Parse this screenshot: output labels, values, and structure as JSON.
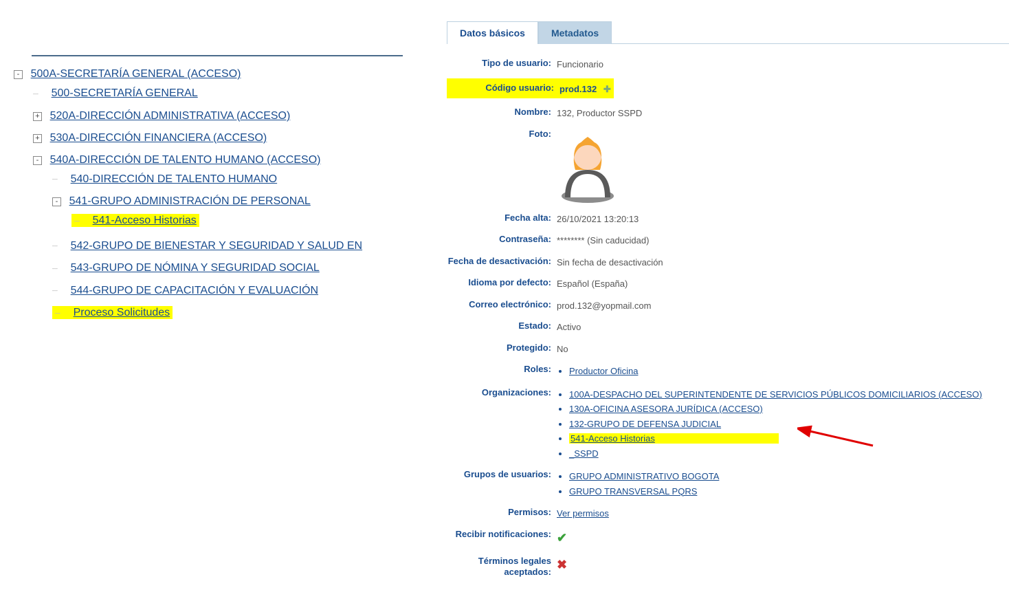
{
  "tree": {
    "root": {
      "exp": "-",
      "label": "500A-SECRETARÍA GENERAL (ACCESO)",
      "children": [
        {
          "exp": "",
          "label": "500-SECRETARÍA GENERAL"
        },
        {
          "exp": "+",
          "label": "520A-DIRECCIÓN ADMINISTRATIVA (ACCESO)"
        },
        {
          "exp": "+",
          "label": "530A-DIRECCIÓN FINANCIERA (ACCESO)"
        },
        {
          "exp": "-",
          "label": "540A-DIRECCIÓN DE TALENTO HUMANO (ACCESO)",
          "children": [
            {
              "exp": "",
              "label": "540-DIRECCIÓN DE TALENTO HUMANO"
            },
            {
              "exp": "-",
              "label": "541-GRUPO ADMINISTRACIÓN DE PERSONAL",
              "children": [
                {
                  "exp": "",
                  "label": "541-Acceso Historias",
                  "highlight": true
                }
              ]
            },
            {
              "exp": "",
              "label": "542-GRUPO DE BIENESTAR Y SEGURIDAD Y SALUD EN"
            },
            {
              "exp": "",
              "label": "543-GRUPO DE NÓMINA Y SEGURIDAD SOCIAL"
            },
            {
              "exp": "",
              "label": "544-GRUPO DE CAPACITACIÓN Y EVALUACIÓN"
            },
            {
              "exp": "",
              "label": "Proceso Solicitudes",
              "highlight": true
            }
          ]
        }
      ]
    }
  },
  "tabs": {
    "active": "Datos básicos",
    "other": "Metadatos"
  },
  "details": {
    "tipo_usuario": {
      "label": "Tipo de usuario:",
      "value": "Funcionario"
    },
    "codigo_usuario": {
      "label": "Código usuario:",
      "value": "prod.132",
      "highlight": true,
      "plus": true
    },
    "nombre": {
      "label": "Nombre:",
      "value": "132, Productor SSPD"
    },
    "foto": {
      "label": "Foto:"
    },
    "fecha_alta": {
      "label": "Fecha alta:",
      "value": "26/10/2021 13:20:13"
    },
    "contrasena": {
      "label": "Contraseña:",
      "value": "******** (Sin caducidad)"
    },
    "fecha_desact": {
      "label": "Fecha de desactivación:",
      "value": "Sin fecha de desactivación"
    },
    "idioma": {
      "label": "Idioma por defecto:",
      "value": "Español (España)"
    },
    "correo": {
      "label": "Correo electrónico:",
      "value": "prod.132@yopmail.com"
    },
    "estado": {
      "label": "Estado:",
      "value": "Activo"
    },
    "protegido": {
      "label": "Protegido:",
      "value": "No"
    },
    "roles": {
      "label": "Roles:",
      "items": [
        "Productor Oficina"
      ]
    },
    "organizaciones": {
      "label": "Organizaciones:",
      "items": [
        "100A-DESPACHO DEL SUPERINTENDENTE DE SERVICIOS PÚBLICOS DOMICILIARIOS (ACCESO)",
        "130A-OFICINA ASESORA JURÍDICA (ACCESO)",
        "132-GRUPO DE DEFENSA JUDICIAL",
        "541-Acceso Historias",
        "_SSPD"
      ],
      "highlight_index": 3
    },
    "grupos": {
      "label": "Grupos de usuarios:",
      "items": [
        "GRUPO ADMINISTRATIVO BOGOTA",
        "GRUPO TRANSVERSAL PQRS"
      ]
    },
    "permisos": {
      "label": "Permisos:",
      "link": "Ver permisos"
    },
    "notificaciones": {
      "label": "Recibir notificaciones:",
      "check": true
    },
    "terminos": {
      "label": "Términos legales aceptados:",
      "cross": true
    }
  }
}
